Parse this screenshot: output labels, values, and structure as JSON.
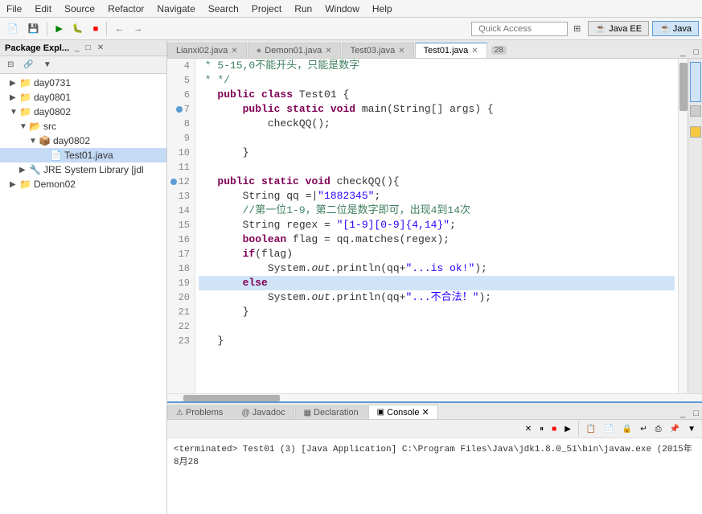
{
  "menubar": {
    "items": [
      "File",
      "Edit",
      "Source",
      "Refactor",
      "Navigate",
      "Search",
      "Project",
      "Run",
      "Window",
      "Help"
    ]
  },
  "toolbar": {
    "quick_access_placeholder": "Quick Access",
    "perspectives": [
      {
        "label": "Java EE",
        "active": false
      },
      {
        "label": "Java",
        "active": true
      }
    ]
  },
  "sidebar": {
    "title": "Package Expl...",
    "trees": [
      {
        "label": "day0731",
        "indent": 1,
        "type": "folder",
        "expanded": true
      },
      {
        "label": "day0801",
        "indent": 1,
        "type": "folder",
        "expanded": false
      },
      {
        "label": "day0802",
        "indent": 1,
        "type": "folder",
        "expanded": true
      },
      {
        "label": "src",
        "indent": 2,
        "type": "src",
        "expanded": true
      },
      {
        "label": "day0802",
        "indent": 3,
        "type": "package",
        "expanded": true
      },
      {
        "label": "Test01.java",
        "indent": 4,
        "type": "java",
        "selected": true
      },
      {
        "label": "JRE System Library [jdl",
        "indent": 2,
        "type": "lib",
        "expanded": false
      },
      {
        "label": "Demon02",
        "indent": 1,
        "type": "folder",
        "expanded": false
      }
    ]
  },
  "editor": {
    "tabs": [
      {
        "label": "Lianxi02.java",
        "active": false,
        "modified": false
      },
      {
        "label": "Demon01.java",
        "active": false,
        "modified": false
      },
      {
        "label": "Test03.java",
        "active": false,
        "modified": false
      },
      {
        "label": "Test01.java",
        "active": true,
        "modified": false
      }
    ],
    "tab_count": "28",
    "lines": [
      {
        "num": 4,
        "content": "    * 5-15,0不能开头，只能是数字",
        "type": "comment",
        "highlight": false
      },
      {
        "num": 5,
        "content": "    * */",
        "type": "comment",
        "highlight": false
      },
      {
        "num": 6,
        "content": "   public class Test01 {",
        "type": "code",
        "highlight": false
      },
      {
        "num": 7,
        "content": "       public static void main(String[] args) {",
        "type": "code",
        "highlight": false,
        "breakpoint": true
      },
      {
        "num": 8,
        "content": "           checkQQ();",
        "type": "code",
        "highlight": false
      },
      {
        "num": 9,
        "content": "",
        "type": "code",
        "highlight": false
      },
      {
        "num": 10,
        "content": "       }",
        "type": "code",
        "highlight": false
      },
      {
        "num": 11,
        "content": "",
        "type": "code",
        "highlight": false
      },
      {
        "num": 12,
        "content": "   public static void checkQQ(){",
        "type": "code",
        "highlight": false,
        "breakpoint": true
      },
      {
        "num": 13,
        "content": "       String qq =\"1882345\";",
        "type": "code",
        "highlight": false
      },
      {
        "num": 14,
        "content": "       //第一位1-9，第二位是数字即可，出现4到14次",
        "type": "comment",
        "highlight": false
      },
      {
        "num": 15,
        "content": "       String regex = \"[1-9][0-9]{4,14}\";",
        "type": "code",
        "highlight": false
      },
      {
        "num": 16,
        "content": "       boolean flag = qq.matches(regex);",
        "type": "code",
        "highlight": false
      },
      {
        "num": 17,
        "content": "       if(flag)",
        "type": "code",
        "highlight": false
      },
      {
        "num": 18,
        "content": "           System.out.println(qq+\"...is ok!\");",
        "type": "code",
        "highlight": false
      },
      {
        "num": 19,
        "content": "       else",
        "type": "code",
        "highlight": true
      },
      {
        "num": 20,
        "content": "           System.out.println(qq+\"...不合法！\");",
        "type": "code",
        "highlight": false
      },
      {
        "num": 21,
        "content": "       }",
        "type": "code",
        "highlight": false
      },
      {
        "num": 22,
        "content": "",
        "type": "code",
        "highlight": false
      },
      {
        "num": 23,
        "content": "   }",
        "type": "code",
        "highlight": false
      }
    ]
  },
  "bottom_panel": {
    "tabs": [
      {
        "label": "Problems",
        "icon": "⚠",
        "active": false
      },
      {
        "label": "Javadoc",
        "icon": "@",
        "active": false
      },
      {
        "label": "Declaration",
        "icon": "▦",
        "active": false
      },
      {
        "label": "Console",
        "icon": "▣",
        "active": true
      }
    ],
    "console_text": "<terminated> Test01 (3) [Java Application] C:\\Program Files\\Java\\jdk1.8.0_51\\bin\\javaw.exe (2015年8月28"
  }
}
